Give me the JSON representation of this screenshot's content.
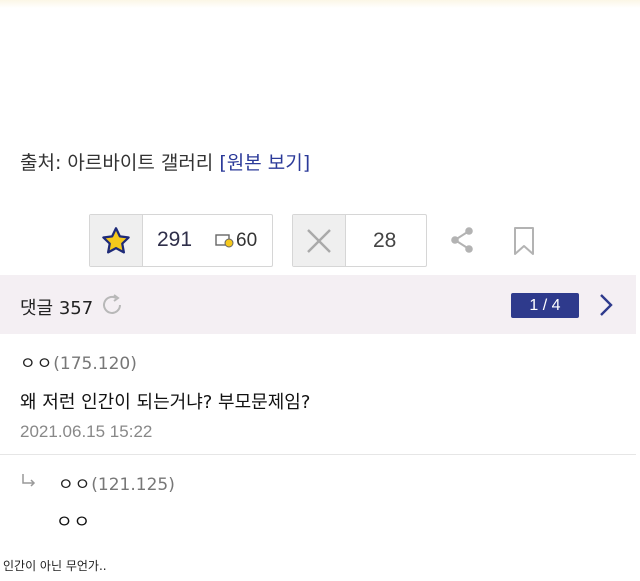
{
  "source": {
    "prefix": "출처: 아르바이트 갤러리 ",
    "link_label": "[원본 보기]"
  },
  "votes": {
    "recommend_count": "291",
    "fixed_recommend_count": "60",
    "not_recommend_count": "28"
  },
  "comments_header": {
    "title": "댓글 357",
    "page_indicator": "1 / 4"
  },
  "comments": [
    {
      "nickname": "ㅇㅇ",
      "ip": "(175.120)",
      "body": "왜 저런 인간이 되는거냐? 부모문제임?",
      "date": "2021.06.15 15:22"
    }
  ],
  "replies": [
    {
      "nickname": "ㅇㅇ",
      "ip": "(121.125)",
      "body": "ㅇㅇ"
    }
  ],
  "caption": "인간이 아닌 무언가..",
  "colors": {
    "accent": "#2e3a8c",
    "link": "#2b3a99",
    "header_bg": "#f4eff3",
    "star_fill": "#f5c81b"
  },
  "icons": [
    "star-icon",
    "fixed-recommend-icon",
    "x-icon",
    "share-icon",
    "bookmark-icon",
    "refresh-icon",
    "chevron-right-icon",
    "reply-arrow-icon"
  ]
}
